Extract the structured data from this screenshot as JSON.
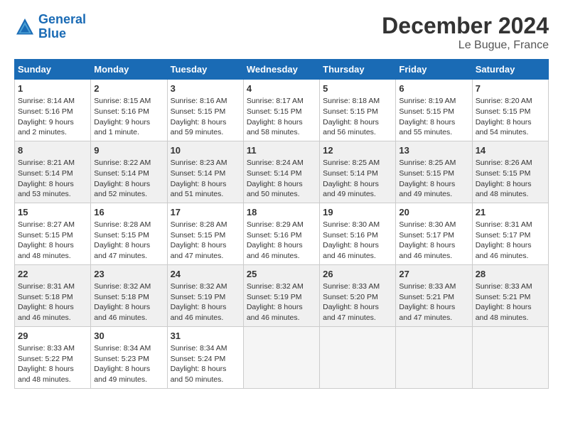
{
  "logo": {
    "line1": "General",
    "line2": "Blue"
  },
  "title": "December 2024",
  "subtitle": "Le Bugue, France",
  "headers": [
    "Sunday",
    "Monday",
    "Tuesday",
    "Wednesday",
    "Thursday",
    "Friday",
    "Saturday"
  ],
  "rows": [
    [
      {
        "day": "1",
        "lines": [
          "Sunrise: 8:14 AM",
          "Sunset: 5:16 PM",
          "Daylight: 9 hours",
          "and 2 minutes."
        ]
      },
      {
        "day": "2",
        "lines": [
          "Sunrise: 8:15 AM",
          "Sunset: 5:16 PM",
          "Daylight: 9 hours",
          "and 1 minute."
        ]
      },
      {
        "day": "3",
        "lines": [
          "Sunrise: 8:16 AM",
          "Sunset: 5:15 PM",
          "Daylight: 8 hours",
          "and 59 minutes."
        ]
      },
      {
        "day": "4",
        "lines": [
          "Sunrise: 8:17 AM",
          "Sunset: 5:15 PM",
          "Daylight: 8 hours",
          "and 58 minutes."
        ]
      },
      {
        "day": "5",
        "lines": [
          "Sunrise: 8:18 AM",
          "Sunset: 5:15 PM",
          "Daylight: 8 hours",
          "and 56 minutes."
        ]
      },
      {
        "day": "6",
        "lines": [
          "Sunrise: 8:19 AM",
          "Sunset: 5:15 PM",
          "Daylight: 8 hours",
          "and 55 minutes."
        ]
      },
      {
        "day": "7",
        "lines": [
          "Sunrise: 8:20 AM",
          "Sunset: 5:15 PM",
          "Daylight: 8 hours",
          "and 54 minutes."
        ]
      }
    ],
    [
      {
        "day": "8",
        "lines": [
          "Sunrise: 8:21 AM",
          "Sunset: 5:14 PM",
          "Daylight: 8 hours",
          "and 53 minutes."
        ]
      },
      {
        "day": "9",
        "lines": [
          "Sunrise: 8:22 AM",
          "Sunset: 5:14 PM",
          "Daylight: 8 hours",
          "and 52 minutes."
        ]
      },
      {
        "day": "10",
        "lines": [
          "Sunrise: 8:23 AM",
          "Sunset: 5:14 PM",
          "Daylight: 8 hours",
          "and 51 minutes."
        ]
      },
      {
        "day": "11",
        "lines": [
          "Sunrise: 8:24 AM",
          "Sunset: 5:14 PM",
          "Daylight: 8 hours",
          "and 50 minutes."
        ]
      },
      {
        "day": "12",
        "lines": [
          "Sunrise: 8:25 AM",
          "Sunset: 5:14 PM",
          "Daylight: 8 hours",
          "and 49 minutes."
        ]
      },
      {
        "day": "13",
        "lines": [
          "Sunrise: 8:25 AM",
          "Sunset: 5:15 PM",
          "Daylight: 8 hours",
          "and 49 minutes."
        ]
      },
      {
        "day": "14",
        "lines": [
          "Sunrise: 8:26 AM",
          "Sunset: 5:15 PM",
          "Daylight: 8 hours",
          "and 48 minutes."
        ]
      }
    ],
    [
      {
        "day": "15",
        "lines": [
          "Sunrise: 8:27 AM",
          "Sunset: 5:15 PM",
          "Daylight: 8 hours",
          "and 48 minutes."
        ]
      },
      {
        "day": "16",
        "lines": [
          "Sunrise: 8:28 AM",
          "Sunset: 5:15 PM",
          "Daylight: 8 hours",
          "and 47 minutes."
        ]
      },
      {
        "day": "17",
        "lines": [
          "Sunrise: 8:28 AM",
          "Sunset: 5:15 PM",
          "Daylight: 8 hours",
          "and 47 minutes."
        ]
      },
      {
        "day": "18",
        "lines": [
          "Sunrise: 8:29 AM",
          "Sunset: 5:16 PM",
          "Daylight: 8 hours",
          "and 46 minutes."
        ]
      },
      {
        "day": "19",
        "lines": [
          "Sunrise: 8:30 AM",
          "Sunset: 5:16 PM",
          "Daylight: 8 hours",
          "and 46 minutes."
        ]
      },
      {
        "day": "20",
        "lines": [
          "Sunrise: 8:30 AM",
          "Sunset: 5:17 PM",
          "Daylight: 8 hours",
          "and 46 minutes."
        ]
      },
      {
        "day": "21",
        "lines": [
          "Sunrise: 8:31 AM",
          "Sunset: 5:17 PM",
          "Daylight: 8 hours",
          "and 46 minutes."
        ]
      }
    ],
    [
      {
        "day": "22",
        "lines": [
          "Sunrise: 8:31 AM",
          "Sunset: 5:18 PM",
          "Daylight: 8 hours",
          "and 46 minutes."
        ]
      },
      {
        "day": "23",
        "lines": [
          "Sunrise: 8:32 AM",
          "Sunset: 5:18 PM",
          "Daylight: 8 hours",
          "and 46 minutes."
        ]
      },
      {
        "day": "24",
        "lines": [
          "Sunrise: 8:32 AM",
          "Sunset: 5:19 PM",
          "Daylight: 8 hours",
          "and 46 minutes."
        ]
      },
      {
        "day": "25",
        "lines": [
          "Sunrise: 8:32 AM",
          "Sunset: 5:19 PM",
          "Daylight: 8 hours",
          "and 46 minutes."
        ]
      },
      {
        "day": "26",
        "lines": [
          "Sunrise: 8:33 AM",
          "Sunset: 5:20 PM",
          "Daylight: 8 hours",
          "and 47 minutes."
        ]
      },
      {
        "day": "27",
        "lines": [
          "Sunrise: 8:33 AM",
          "Sunset: 5:21 PM",
          "Daylight: 8 hours",
          "and 47 minutes."
        ]
      },
      {
        "day": "28",
        "lines": [
          "Sunrise: 8:33 AM",
          "Sunset: 5:21 PM",
          "Daylight: 8 hours",
          "and 48 minutes."
        ]
      }
    ],
    [
      {
        "day": "29",
        "lines": [
          "Sunrise: 8:33 AM",
          "Sunset: 5:22 PM",
          "Daylight: 8 hours",
          "and 48 minutes."
        ]
      },
      {
        "day": "30",
        "lines": [
          "Sunrise: 8:34 AM",
          "Sunset: 5:23 PM",
          "Daylight: 8 hours",
          "and 49 minutes."
        ]
      },
      {
        "day": "31",
        "lines": [
          "Sunrise: 8:34 AM",
          "Sunset: 5:24 PM",
          "Daylight: 8 hours",
          "and 50 minutes."
        ]
      },
      null,
      null,
      null,
      null
    ]
  ]
}
